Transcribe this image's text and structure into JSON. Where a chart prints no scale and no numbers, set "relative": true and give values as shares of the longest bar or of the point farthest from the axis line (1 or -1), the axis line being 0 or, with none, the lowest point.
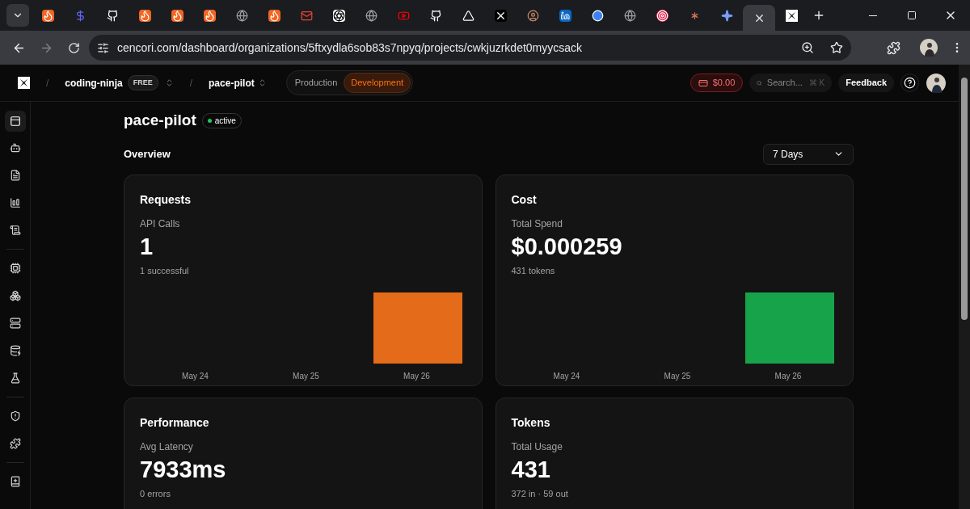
{
  "browser": {
    "tabs": [
      {
        "kind": "flame",
        "selected": false
      },
      {
        "kind": "dollar",
        "selected": false
      },
      {
        "kind": "github",
        "selected": false
      },
      {
        "kind": "flame",
        "selected": false
      },
      {
        "kind": "flame",
        "selected": false
      },
      {
        "kind": "flame",
        "selected": false
      },
      {
        "kind": "globe",
        "selected": false
      },
      {
        "kind": "flame",
        "selected": false
      },
      {
        "kind": "mail",
        "selected": false
      },
      {
        "kind": "knot",
        "selected": false
      },
      {
        "kind": "globe",
        "selected": false
      },
      {
        "kind": "play",
        "selected": false
      },
      {
        "kind": "github",
        "selected": false
      },
      {
        "kind": "triangle",
        "selected": false
      },
      {
        "kind": "x",
        "selected": false
      },
      {
        "kind": "person",
        "selected": false
      },
      {
        "kind": "linkedin",
        "selected": false
      },
      {
        "kind": "ring",
        "selected": false
      },
      {
        "kind": "globe",
        "selected": false
      },
      {
        "kind": "target",
        "selected": false
      },
      {
        "kind": "burst",
        "selected": false
      },
      {
        "kind": "sparkle",
        "selected": false
      },
      {
        "kind": "close",
        "selected": true
      },
      {
        "kind": "logo",
        "selected": false
      }
    ],
    "url": "cencori.com/dashboard/organizations/5ftxydla6sob83s7npyq/projects/cwkjuzrkdet0myycsack"
  },
  "header": {
    "separators": [
      "/",
      "/"
    ],
    "org": "coding-ninja",
    "plan": "FREE",
    "project": "pace-pilot",
    "environments": [
      {
        "label": "Production",
        "selected": false
      },
      {
        "label": "Development",
        "selected": true
      }
    ],
    "balance": "$0.00",
    "search": {
      "placeholder": "Search...",
      "shortcut": "⌘ K"
    },
    "feedback": "Feedback"
  },
  "sidebar": {
    "groups": [
      [
        {
          "kind": "panel",
          "selected": true
        },
        {
          "kind": "bot",
          "selected": false
        },
        {
          "kind": "file",
          "selected": false
        },
        {
          "kind": "chart",
          "selected": false
        },
        {
          "kind": "scroll",
          "selected": false
        }
      ],
      [
        {
          "kind": "cpu",
          "selected": false
        },
        {
          "kind": "boxes",
          "selected": false
        },
        {
          "kind": "server",
          "selected": false
        },
        {
          "kind": "database",
          "selected": false
        },
        {
          "kind": "flask",
          "selected": false
        }
      ],
      [
        {
          "kind": "shield",
          "selected": false
        },
        {
          "kind": "puzzle",
          "selected": false
        }
      ],
      [
        {
          "kind": "book",
          "selected": false
        }
      ]
    ]
  },
  "project": {
    "name": "pace-pilot",
    "status": "active"
  },
  "overview": {
    "title": "Overview",
    "range": "7 Days"
  },
  "cards": [
    {
      "title": "Requests",
      "label": "API Calls",
      "value": "1",
      "sub": "1 successful",
      "chart_data": {
        "type": "bar",
        "relative": true,
        "categories": [
          "May 24",
          "May 25",
          "May 26"
        ],
        "series": [
          {
            "color": "#e36b1a",
            "values": [
              0,
              0,
              1
            ]
          }
        ]
      }
    },
    {
      "title": "Cost",
      "label": "Total Spend",
      "value": "$0.000259",
      "sub": "431 tokens",
      "chart_data": {
        "type": "bar",
        "relative": true,
        "categories": [
          "May 24",
          "May 25",
          "May 26"
        ],
        "series": [
          {
            "color": "#16a34a",
            "values": [
              0,
              0,
              1
            ]
          }
        ]
      }
    },
    {
      "title": "Performance",
      "label": "Avg Latency",
      "value": "7933ms",
      "sub": "0 errors"
    },
    {
      "title": "Tokens",
      "label": "Total Usage",
      "value": "431",
      "sub": "372 in · 59 out"
    }
  ]
}
